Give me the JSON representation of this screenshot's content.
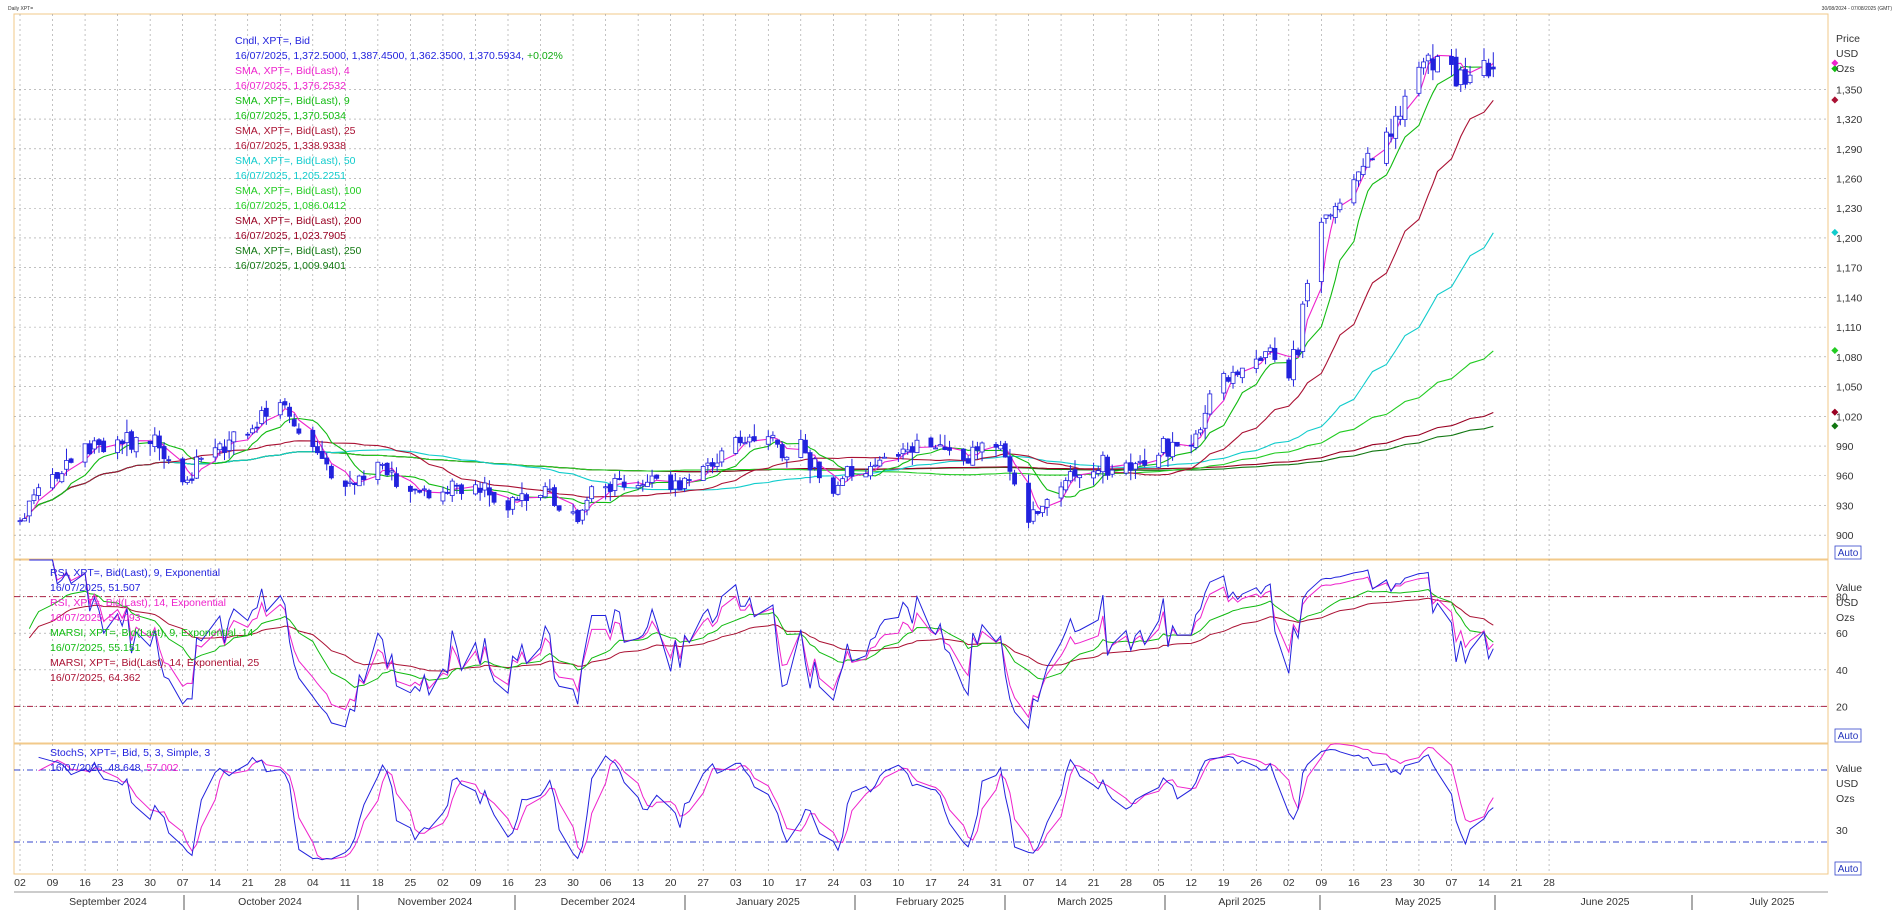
{
  "window": {
    "title": "Daily XPT=",
    "range": "30/08/2024 - 07/08/2025 (GMT)"
  },
  "colors": {
    "blue": "#2222dd",
    "magenta": "#ee22cc",
    "green": "#11bb11",
    "darkred": "#aa1133",
    "cyan": "#11cccc",
    "green100": "#22cc22",
    "darkred200": "#990022",
    "darkgreen250": "#117711",
    "ref": "#aa2244"
  },
  "price_panel": {
    "legend": [
      {
        "text": "Cndl, XPT=, Bid",
        "color": "#2222dd"
      },
      {
        "text": "16/07/2025, 1,372.5000, 1,387.4500, 1,362.3500, 1,370.5934, ",
        "suffix": "+0.02%",
        "color": "#2222dd",
        "suffix_color": "#11aa11"
      },
      {
        "text": "SMA, XPT=, Bid(Last),  4",
        "color": "#ee22cc"
      },
      {
        "text": "16/07/2025, 1,376.2532",
        "color": "#ee22cc"
      },
      {
        "text": "SMA, XPT=, Bid(Last),  9",
        "color": "#11bb11"
      },
      {
        "text": "16/07/2025, 1,370.5034",
        "color": "#11bb11"
      },
      {
        "text": "SMA, XPT=, Bid(Last),  25",
        "color": "#aa1133"
      },
      {
        "text": "16/07/2025, 1,338.9338",
        "color": "#aa1133"
      },
      {
        "text": "SMA, XPT=, Bid(Last),  50",
        "color": "#11cccc"
      },
      {
        "text": "16/07/2025, 1,205.2251",
        "color": "#11cccc"
      },
      {
        "text": "SMA, XPT=, Bid(Last),  100",
        "color": "#22cc22"
      },
      {
        "text": "16/07/2025, 1,086.0412",
        "color": "#22cc22"
      },
      {
        "text": "SMA, XPT=, Bid(Last),  200",
        "color": "#990022"
      },
      {
        "text": "16/07/2025, 1,023.7905",
        "color": "#990022"
      },
      {
        "text": "SMA, XPT=, Bid(Last),  250",
        "color": "#117711"
      },
      {
        "text": "16/07/2025, 1,009.9401",
        "color": "#117711"
      }
    ],
    "axis_header": [
      "Price",
      "USD",
      "Ozs"
    ],
    "yticks": [
      "1,350",
      "1,320",
      "1,290",
      "1,260",
      "1,230",
      "1,200",
      "1,170",
      "1,140",
      "1,110",
      "1,080",
      "1,050",
      "1,020",
      "990",
      "960",
      "930",
      "900"
    ],
    "auto_label": "Auto"
  },
  "rsi_panel": {
    "legend": [
      {
        "text": "RSI, XPT=, Bid(Last),  9, Exponential",
        "color": "#2222dd"
      },
      {
        "text": "16/07/2025, 51.507",
        "color": "#2222dd"
      },
      {
        "text": "RSI, XPT=, Bid(Last),  14, Exponential",
        "color": "#ee22cc"
      },
      {
        "text": "16/07/2025, 54.093",
        "color": "#ee22cc"
      },
      {
        "text": "MARSI, XPT=, Bid(Last),  9, Exponential, 14",
        "color": "#11bb11"
      },
      {
        "text": "16/07/2025, 55.151",
        "color": "#11bb11"
      },
      {
        "text": "MARSI, XPT=, Bid(Last),  14, Exponential, 25",
        "color": "#aa1133"
      },
      {
        "text": "16/07/2025, 64.362",
        "color": "#aa1133"
      }
    ],
    "axis_header": [
      "Value",
      "USD",
      "Ozs"
    ],
    "yticks": [
      "80",
      "60",
      "40",
      "20"
    ],
    "auto_label": "Auto"
  },
  "stoch_panel": {
    "legend": [
      {
        "text": "StochS, XPT=, Bid,  5, 3, Simple, 3",
        "color": "#2222dd"
      },
      {
        "text": "16/07/2025, 48.648, ",
        "suffix": "57.002",
        "color": "#2222dd",
        "suffix_color": "#ee22cc"
      }
    ],
    "axis_header": [
      "Value",
      "USD",
      "Ozs"
    ],
    "yticks": [
      "30"
    ],
    "auto_label": "Auto"
  },
  "x_axis": {
    "days": [
      "02",
      "09",
      "16",
      "23",
      "30",
      "07",
      "14",
      "21",
      "28",
      "04",
      "11",
      "18",
      "25",
      "02",
      "09",
      "16",
      "23",
      "30",
      "06",
      "13",
      "20",
      "27",
      "03",
      "10",
      "17",
      "24",
      "03",
      "10",
      "17",
      "24",
      "31",
      "07",
      "14",
      "21",
      "28",
      "05",
      "12",
      "19",
      "26",
      "02",
      "09",
      "16",
      "23",
      "30",
      "07",
      "14",
      "21",
      "28"
    ],
    "months": [
      "September 2024",
      "October 2024",
      "November 2024",
      "December 2024",
      "January 2025",
      "February 2025",
      "March 2025",
      "April 2025",
      "May 2025",
      "June 2025",
      "July 2025"
    ]
  },
  "chart_data": {
    "type": "candlestick",
    "instrument": "XPT=",
    "interval": "Daily",
    "date_range": [
      "30/08/2024",
      "07/08/2025"
    ],
    "last_bar": {
      "date": "16/07/2025",
      "open": 1372.5,
      "high": 1387.45,
      "low": 1362.35,
      "close": 1370.5934,
      "change": "+0.02%"
    },
    "price_axis": {
      "ylim": [
        880,
        1420
      ],
      "ticks": [
        900,
        930,
        960,
        990,
        1020,
        1050,
        1080,
        1110,
        1140,
        1170,
        1200,
        1230,
        1260,
        1290,
        1320,
        1350
      ]
    },
    "close_weekly": [
      [
        "2024-09-02",
        915
      ],
      [
        "2024-09-09",
        960
      ],
      [
        "2024-09-16",
        985
      ],
      [
        "2024-09-23",
        995
      ],
      [
        "2024-09-30",
        990
      ],
      [
        "2024-10-07",
        960
      ],
      [
        "2024-10-14",
        985
      ],
      [
        "2024-10-21",
        1010
      ],
      [
        "2024-10-28",
        1035
      ],
      [
        "2024-11-04",
        985
      ],
      [
        "2024-11-11",
        950
      ],
      [
        "2024-11-18",
        975
      ],
      [
        "2024-11-25",
        940
      ],
      [
        "2024-12-02",
        950
      ],
      [
        "2024-12-09",
        945
      ],
      [
        "2024-12-16",
        935
      ],
      [
        "2024-12-23",
        940
      ],
      [
        "2024-12-30",
        915
      ],
      [
        "2025-01-06",
        955
      ],
      [
        "2025-01-13",
        950
      ],
      [
        "2025-01-20",
        945
      ],
      [
        "2025-01-27",
        965
      ],
      [
        "2025-02-03",
        995
      ],
      [
        "2025-02-10",
        995
      ],
      [
        "2025-02-17",
        985
      ],
      [
        "2025-02-24",
        950
      ],
      [
        "2025-03-03",
        965
      ],
      [
        "2025-03-10",
        985
      ],
      [
        "2025-03-17",
        995
      ],
      [
        "2025-03-24",
        975
      ],
      [
        "2025-03-31",
        990
      ],
      [
        "2025-04-07",
        920
      ],
      [
        "2025-04-14",
        955
      ],
      [
        "2025-04-21",
        975
      ],
      [
        "2025-04-28",
        970
      ],
      [
        "2025-05-05",
        985
      ],
      [
        "2025-05-12",
        995
      ],
      [
        "2025-05-19",
        1060
      ],
      [
        "2025-05-26",
        1075
      ],
      [
        "2025-06-02",
        1065
      ],
      [
        "2025-06-09",
        1215
      ],
      [
        "2025-06-16",
        1265
      ],
      [
        "2025-06-23",
        1300
      ],
      [
        "2025-06-30",
        1375
      ],
      [
        "2025-07-07",
        1365
      ],
      [
        "2025-07-14",
        1370
      ]
    ],
    "sma_last": {
      "4": 1376.2532,
      "9": 1370.5034,
      "25": 1338.9338,
      "50": 1205.2251,
      "100": 1086.0412,
      "200": 1023.7905,
      "250": 1009.9401
    },
    "rsi": {
      "ylim": [
        0,
        100
      ],
      "ticks": [
        20,
        40,
        60,
        80
      ],
      "reference_lines": [
        20,
        80
      ],
      "last": {
        "rsi9": 51.507,
        "rsi14": 54.093,
        "marsi9": 55.151,
        "marsi14": 64.362
      }
    },
    "stochastic": {
      "ylim": [
        0,
        100
      ],
      "ticks": [
        30
      ],
      "reference_lines": [
        20,
        80
      ],
      "last": {
        "k": 48.648,
        "d": 57.002
      }
    }
  }
}
